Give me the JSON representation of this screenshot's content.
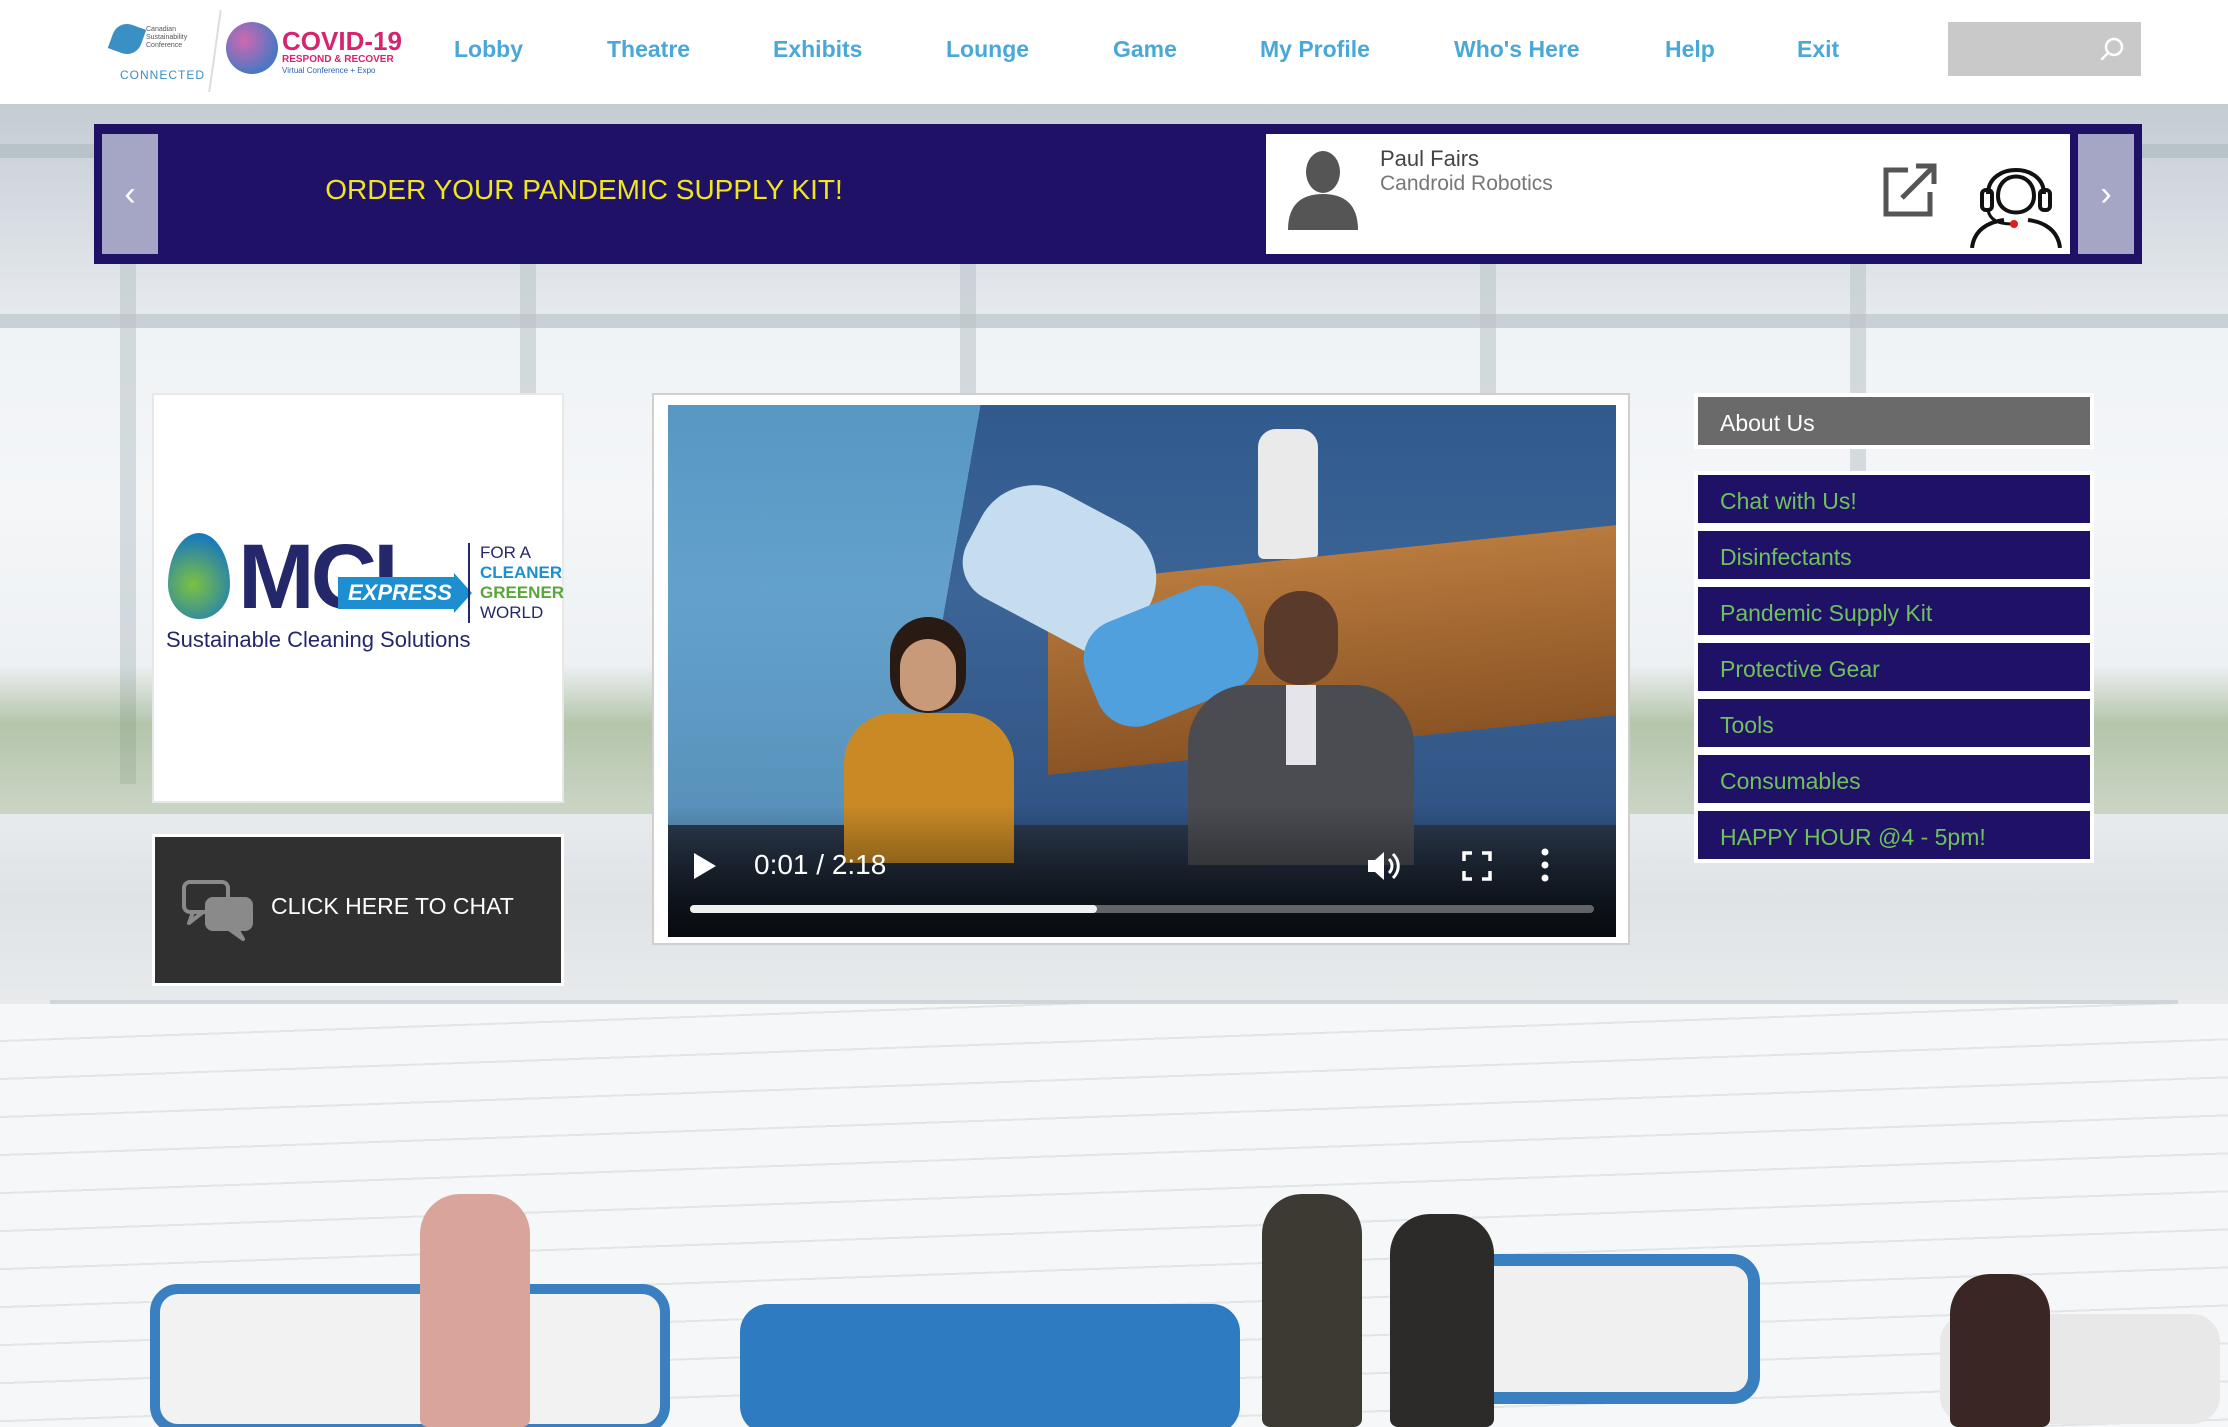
{
  "nav": {
    "items": [
      "Lobby",
      "Theatre",
      "Exhibits",
      "Lounge",
      "Game",
      "My Profile",
      "Who's Here",
      "Help",
      "Exit"
    ],
    "search_placeholder": ""
  },
  "logos": {
    "csc_small": "Canadian Sustainability Conference",
    "csc_connected": "CONNECTED",
    "covid_title": "COVID-19",
    "covid_sub": "RESPOND & RECOVER",
    "covid_tag": "Virtual Conference + Expo"
  },
  "banner": {
    "text": "ORDER YOUR PANDEMIC SUPPLY KIT!",
    "prev_label": "‹",
    "next_label": "›",
    "contact_name": "Paul Fairs",
    "contact_org": "Candroid Robotics"
  },
  "booth_logo": {
    "mark": "MCL",
    "express": "EXPRESS",
    "tagline": "Sustainable Cleaning Solutions",
    "side1": "FOR A",
    "side2": "CLEANER",
    "side3": "GREENER",
    "side4": "WORLD"
  },
  "chat": {
    "label": "CLICK HERE TO CHAT"
  },
  "video": {
    "time": "0:01 / 2:18",
    "progress_fraction": 0.45
  },
  "menu": {
    "about": "About Us",
    "items": [
      "Chat with Us!",
      "Disinfectants",
      "Pandemic Supply Kit",
      "Protective Gear",
      "Tools",
      "Consumables",
      "HAPPY HOUR @4 - 5pm!"
    ]
  },
  "colors": {
    "nav_text": "#4aa8d8",
    "banner_bg": "#1f1266",
    "banner_text": "#f1e51c",
    "menu_text": "#6fc25a"
  }
}
